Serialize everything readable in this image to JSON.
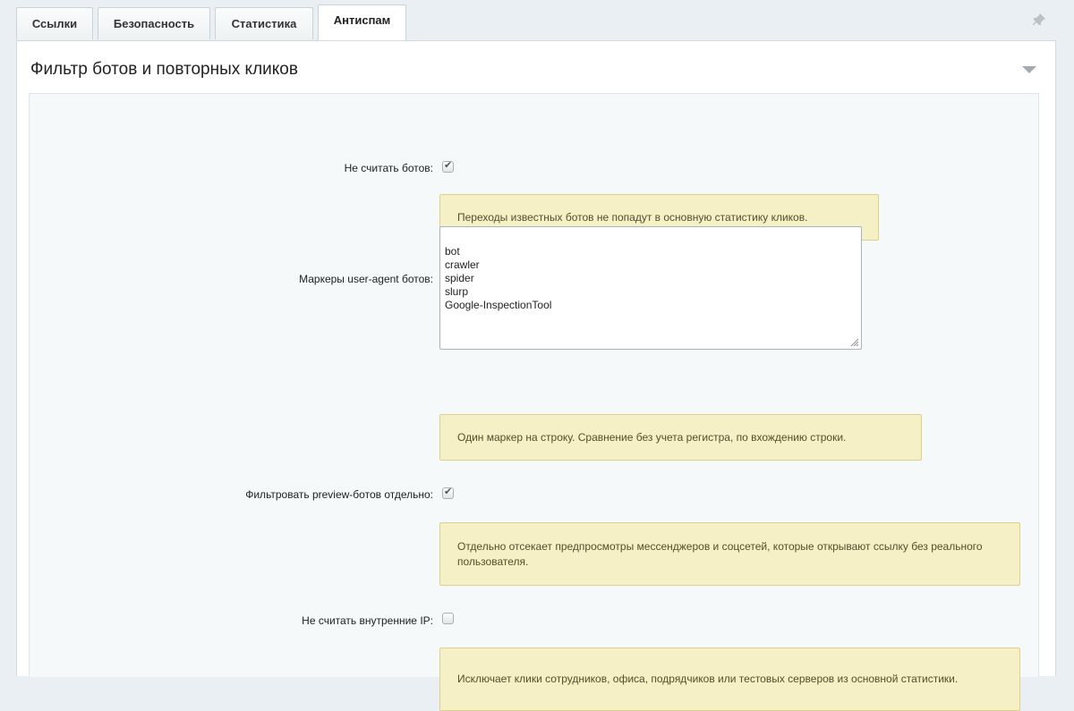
{
  "tabs": [
    {
      "label": "Ссылки"
    },
    {
      "label": "Безопасность"
    },
    {
      "label": "Статистика"
    },
    {
      "label": "Антиспам",
      "active": true
    }
  ],
  "section": {
    "title": "Фильтр ботов и повторных кликов"
  },
  "fields": {
    "skip_bots": {
      "label": "Не считать ботов:",
      "checked": true,
      "hint": "Переходы известных ботов не попадут в основную статистику кликов."
    },
    "ua_markers": {
      "label": "Маркеры user-agent ботов:",
      "value": "bot\ncrawler\nspider\nslurp\nGoogle-InspectionTool",
      "hint": "Один маркер на строку. Сравнение без учета регистра, по вхождению строки."
    },
    "preview_bots": {
      "label": "Фильтровать preview-ботов отдельно:",
      "checked": true,
      "hint": "Отдельно отсекает предпросмотры мессенджеров и соцсетей, которые открывают ссылку без реального пользователя."
    },
    "internal_ip": {
      "label": "Не считать внутренние IP:",
      "checked": false,
      "hint": "Исключает клики сотрудников, офиса, подрядчиков или тестовых серверов из основной статистики."
    }
  },
  "icons": {
    "pin": "pin-icon",
    "collapse": "chevron-down-icon",
    "check": "check-icon",
    "resize": "resize-grip-icon"
  }
}
